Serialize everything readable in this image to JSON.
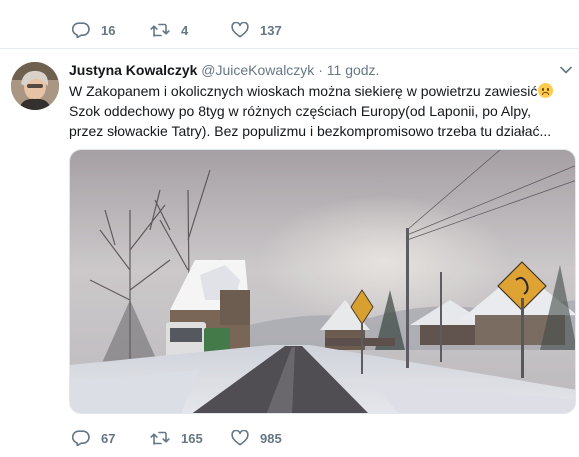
{
  "previous_tweet": {
    "reply_count": "16",
    "retweet_count": "4",
    "like_count": "137"
  },
  "tweet": {
    "author_name": "Justyna Kowalczyk",
    "author_handle": "@JuiceKowalczyk",
    "separator": "·",
    "time_ago": "11 godz.",
    "text_line1": "W Zakopanem i okolicznych wioskach można siekierę w powietrzu zawiesić",
    "text_rest": "Szok oddechowy po 8tyg w różnych częściach Europy(od Laponii, po Alpy, przez słowackie Tatry). Bez populizmu i bezkompromisowo trzeba tu działać...",
    "emoji": "frowning-face",
    "reply_count": "67",
    "retweet_count": "165",
    "like_count": "985"
  },
  "colors": {
    "text": "#14171a",
    "secondary": "#657786",
    "divider": "#e6ecf0",
    "photo_sky": "#c8c3c6"
  },
  "icons": [
    "reply-icon",
    "retweet-icon",
    "like-icon",
    "chevron-down-icon"
  ]
}
